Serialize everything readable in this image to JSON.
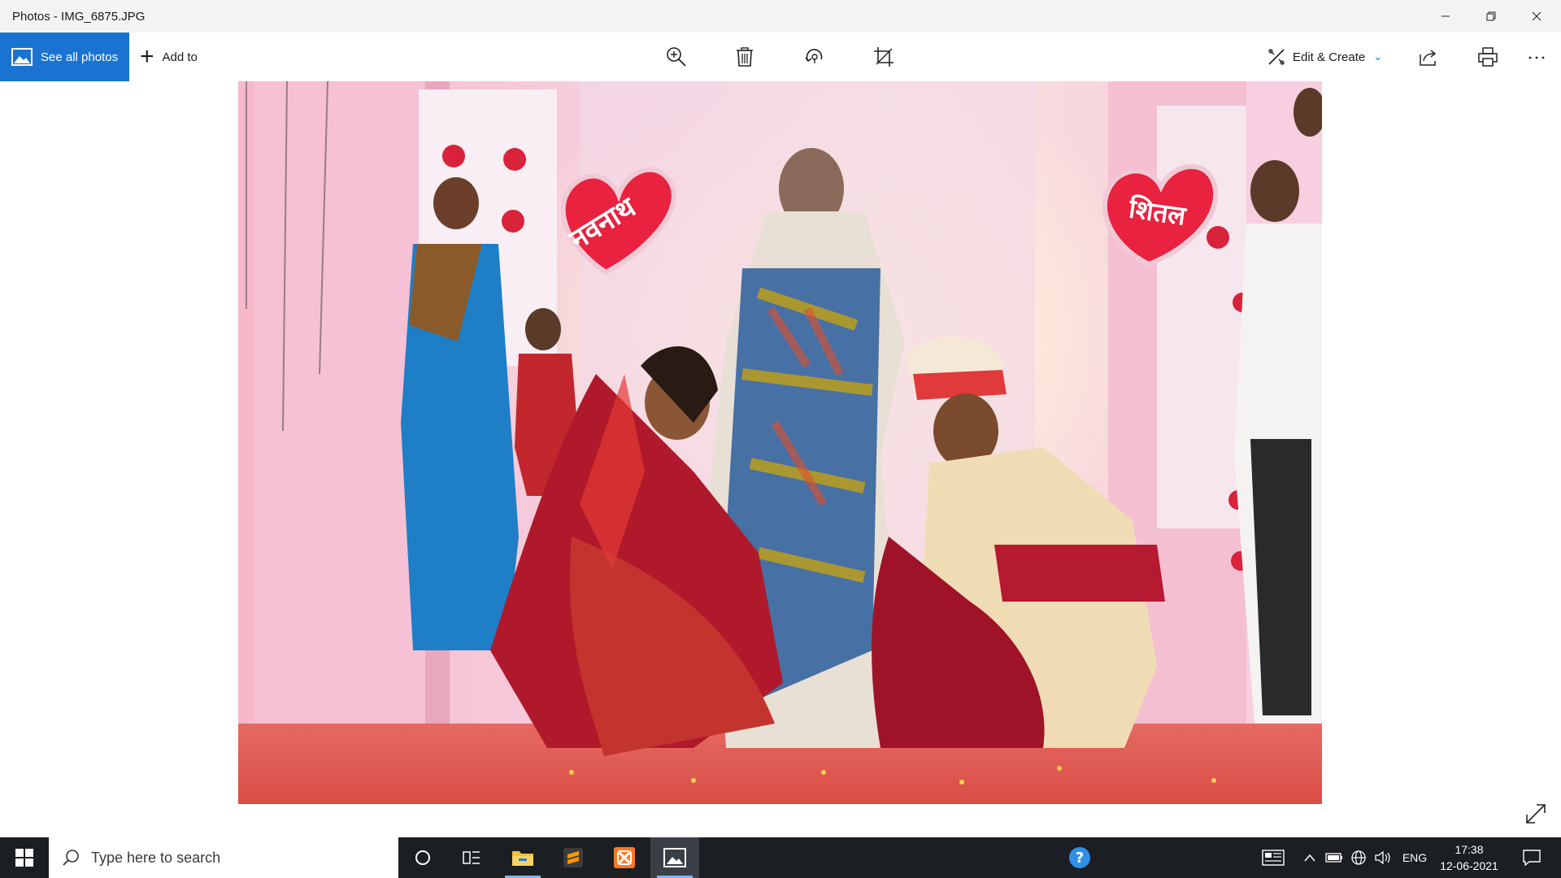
{
  "window": {
    "title": "Photos - IMG_6875.JPG"
  },
  "toolbar": {
    "see_all_label": "See all photos",
    "add_to_label": "Add to",
    "edit_create_label": "Edit & Create"
  },
  "photo": {
    "sign_left": "नवनाथ",
    "sign_right": "शितल"
  },
  "taskbar": {
    "search_placeholder": "Type here to search",
    "language": "ENG",
    "time": "17:38",
    "date": "12-06-2021"
  },
  "colors": {
    "accent": "#1a73d1",
    "taskbar": "#1b1f24"
  }
}
